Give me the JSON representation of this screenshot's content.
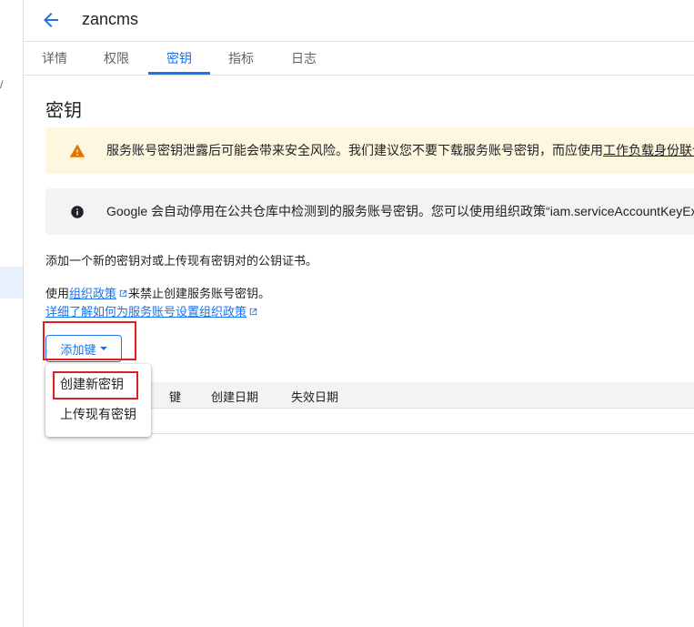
{
  "app": {
    "title": "zancms"
  },
  "rail": {
    "mark": "/"
  },
  "tabs": [
    {
      "label": "详情"
    },
    {
      "label": "权限"
    },
    {
      "label": "密钥"
    },
    {
      "label": "指标"
    },
    {
      "label": "日志"
    }
  ],
  "section": {
    "title": "密钥"
  },
  "warning_banner": {
    "text": "服务账号密钥泄露后可能会带来安全风险。我们建议您不要下载服务账号密钥，而应使用",
    "link": "工作负载身份联合"
  },
  "info_banner": {
    "text": "Google 会自动停用在公共仓库中检测到的服务账号密钥。您可以使用组织政策“iam.serviceAccountKeyEx"
  },
  "description": "添加一个新的密钥对或上传现有密钥对的公钥证书。",
  "policy": {
    "prefix": "使用",
    "link": "组织政策",
    "suffix": "来禁止创建服务账号密钥。",
    "learn_more": "详细了解如何为服务账号设置组织政策"
  },
  "add_key_button": {
    "label": "添加键"
  },
  "table": {
    "headers": [
      "键",
      "创建日期",
      "失效日期"
    ]
  },
  "dropdown": {
    "items": [
      "创建新密钥",
      "上传现有密钥"
    ]
  },
  "colors": {
    "accent": "#1a73e8",
    "warning": "#e37400",
    "highlight": "#e02020"
  }
}
